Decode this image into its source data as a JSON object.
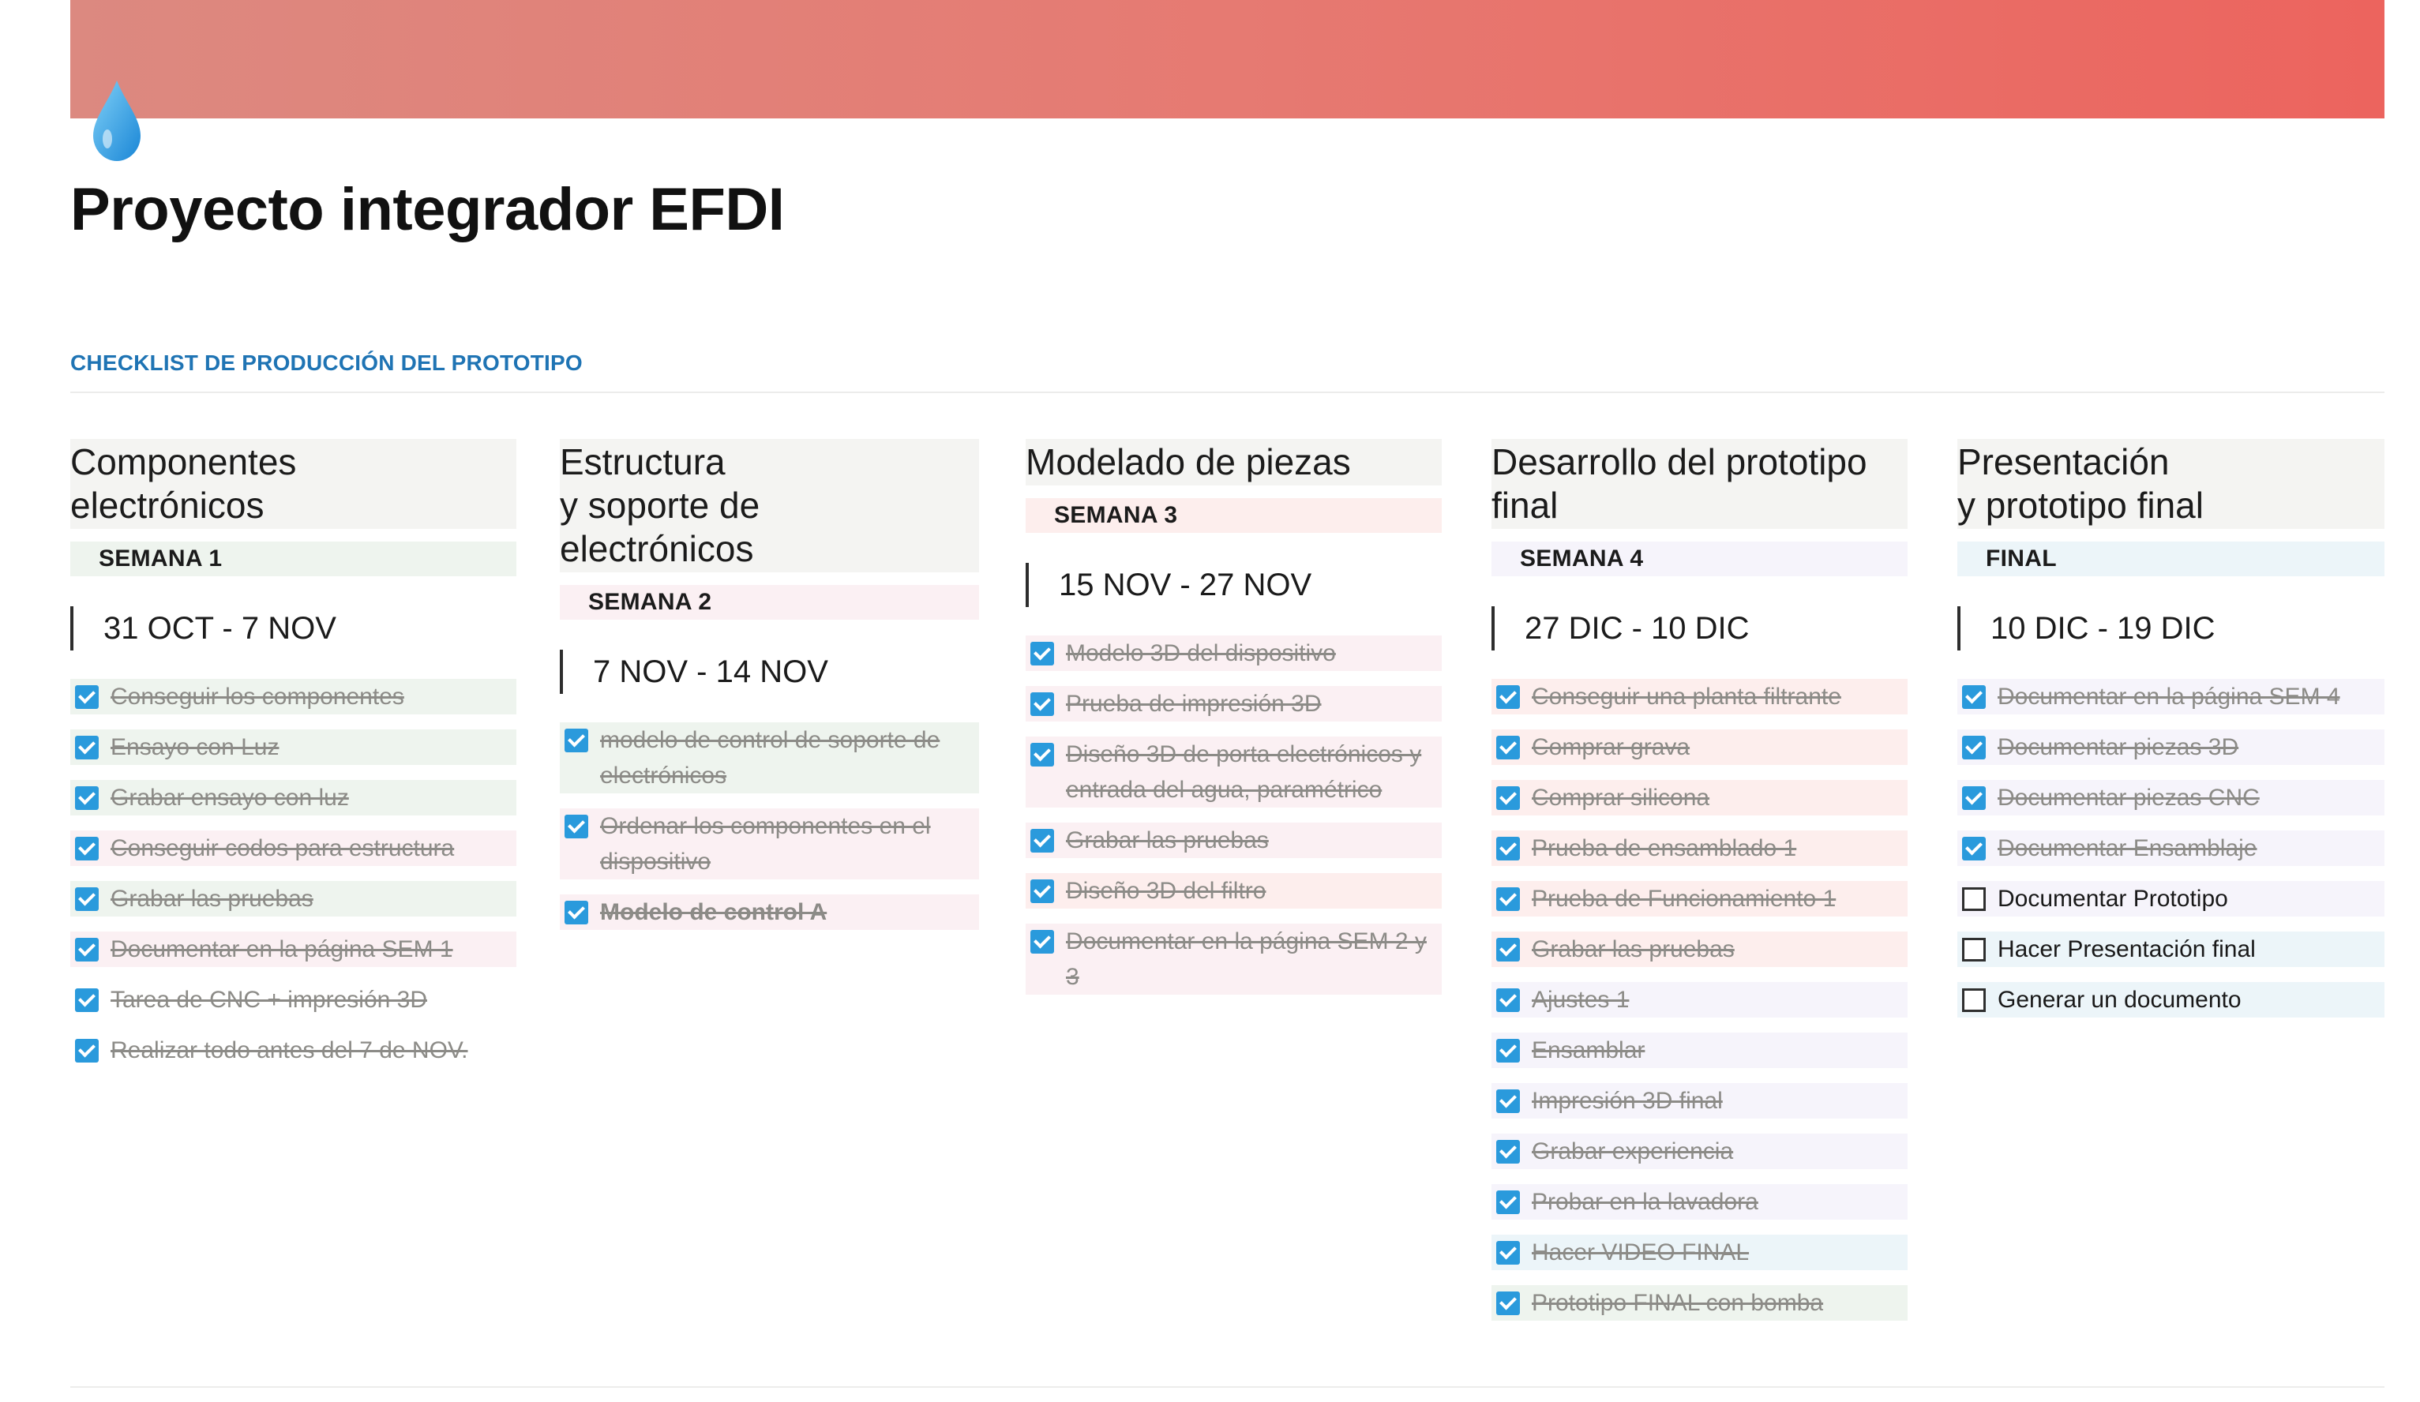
{
  "page": {
    "title": "Proyecto integrador EFDI",
    "icon": "water-drop-icon",
    "cover_colors": [
      "#dc8980",
      "#e67a72",
      "#ec645e"
    ],
    "section_heading": "CHECKLIST DE PRODUCCIÓN DEL PROTOTIPO",
    "section_heading_color": "#1f74b4"
  },
  "colors": {
    "checkbox_checked": "#2a9adc",
    "done_text": "#8c8b87",
    "tint_green": "#eef4ee",
    "tint_pink": "#fbf0f3",
    "tint_red": "#fdeeed",
    "tint_lavender": "#f6f4fb",
    "tint_blue": "#ecf5f9",
    "tint_gray": "#f4f4f2"
  },
  "columns": [
    {
      "title": "Componentes\nelectrónicos",
      "week": "SEMANA 1",
      "week_color": "#eef4ee",
      "date_range": "31 OCT - 7 NOV",
      "tasks": [
        {
          "label": "Conseguir los componentes",
          "done": true,
          "tint": "#eef4ee"
        },
        {
          "label": "Ensayo con Luz",
          "done": true,
          "tint": "#eef4ee"
        },
        {
          "label": "Grabar ensayo con luz",
          "done": true,
          "tint": "#eef4ee"
        },
        {
          "label": "Conseguir codos para estructura",
          "done": true,
          "tint": "#fbf0f3"
        },
        {
          "label": "Grabar las pruebas",
          "done": true,
          "tint": "#eef4ee"
        },
        {
          "label": "Documentar en la página SEM 1",
          "done": true,
          "tint": "#fbf0f3"
        },
        {
          "label": "Tarea de CNC + impresión 3D",
          "done": true,
          "tint": "#ffffff"
        },
        {
          "label": "Realizar todo antes del 7 de NOV.",
          "done": true,
          "tint": "#ffffff"
        }
      ]
    },
    {
      "title": "Estructura\ny soporte de\nelectrónicos",
      "week": "SEMANA 2",
      "week_color": "#fbf0f3",
      "date_range": "7 NOV - 14 NOV",
      "tasks": [
        {
          "label": "modelo de control de soporte de electrónicos",
          "done": true,
          "tint": "#eef4ee"
        },
        {
          "label": "Ordenar los componentes en el dispositivo",
          "done": true,
          "tint": "#fbf0f3"
        },
        {
          "label": "Modelo de control A",
          "done": true,
          "bold": true,
          "tint": "#fbf0f3"
        }
      ]
    },
    {
      "title": "Modelado de piezas",
      "week": "SEMANA 3",
      "week_color": "#fdeeed",
      "date_range": "15 NOV - 27 NOV",
      "tasks": [
        {
          "label": "Modelo 3D del dispositivo",
          "done": true,
          "tint": "#fbf0f3"
        },
        {
          "label": "Prueba de impresión 3D",
          "done": true,
          "tint": "#fbf0f3"
        },
        {
          "label": "Diseño 3D de porta electrónicos y entrada del agua, paramétrico",
          "done": true,
          "tint": "#fbf0f3"
        },
        {
          "label": "Grabar las pruebas",
          "done": true,
          "tint": "#fbf0f3"
        },
        {
          "label": "Diseño 3D del filtro",
          "done": true,
          "tint": "#fdeeed"
        },
        {
          "label": "Documentar en la página SEM 2 y 3",
          "done": true,
          "tint": "#fbf0f3"
        }
      ]
    },
    {
      "title": "Desarrollo del prototipo\nfinal",
      "week": "SEMANA 4",
      "week_color": "#f6f4fb",
      "date_range": "27 DIC - 10 DIC",
      "tasks": [
        {
          "label": "Conseguir una planta filtrante",
          "done": true,
          "tint": "#fdeeed"
        },
        {
          "label": "Comprar grava",
          "done": true,
          "tint": "#fdeeed"
        },
        {
          "label": "Comprar silicona",
          "done": true,
          "tint": "#fdeeed"
        },
        {
          "label": "Prueba de ensamblado 1",
          "done": true,
          "tint": "#fdeeed"
        },
        {
          "label": "Prueba de Funcionamiento 1",
          "done": true,
          "tint": "#fdeeed"
        },
        {
          "label": "Grabar las pruebas",
          "done": true,
          "tint": "#fdeeed"
        },
        {
          "label": "Ajustes 1",
          "done": true,
          "tint": "#f6f4fb"
        },
        {
          "label": "Ensamblar",
          "done": true,
          "tint": "#f6f4fb"
        },
        {
          "label": "Impresión 3D final",
          "done": true,
          "tint": "#f6f4fb"
        },
        {
          "label": "Grabar experiencia",
          "done": true,
          "tint": "#f6f4fb"
        },
        {
          "label": "Probar en la lavadora",
          "done": true,
          "tint": "#f6f4fb"
        },
        {
          "label": "Hacer VIDEO FINAL",
          "done": true,
          "tint": "#ecf5f9"
        },
        {
          "label": "Prototipo FINAL con bomba",
          "done": true,
          "tint": "#eef4ee"
        }
      ]
    },
    {
      "title": "Presentación\ny prototipo final",
      "week": "FINAL",
      "week_color": "#ecf5f9",
      "date_range": "10 DIC - 19 DIC",
      "tasks": [
        {
          "label": "Documentar en la página SEM 4",
          "done": true,
          "tint": "#f6f4fb"
        },
        {
          "label": "Documentar piezas 3D",
          "done": true,
          "tint": "#f6f4fb"
        },
        {
          "label": "Documentar piezas CNC",
          "done": true,
          "tint": "#f6f4fb"
        },
        {
          "label": "Documentar Ensamblaje",
          "done": true,
          "tint": "#f6f4fb"
        },
        {
          "label": "Documentar Prototipo",
          "done": false,
          "tint": "#f6f4fb"
        },
        {
          "label": "Hacer Presentación final",
          "done": false,
          "tint": "#ecf5f9"
        },
        {
          "label": "Generar un documento",
          "done": false,
          "tint": "#ecf5f9"
        }
      ]
    }
  ]
}
